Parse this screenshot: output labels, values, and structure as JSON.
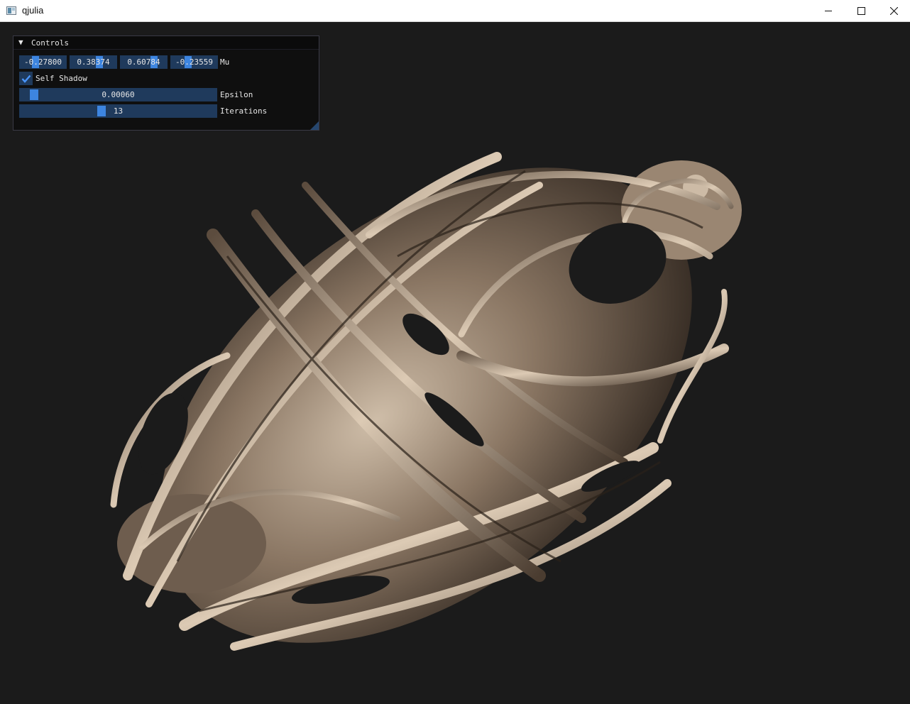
{
  "window": {
    "title": "qjulia",
    "controls": {
      "minimize": "minimize-icon",
      "maximize": "maximize-icon",
      "close": "close-icon"
    }
  },
  "panel": {
    "title": "Controls",
    "mu": {
      "label": "Mu",
      "values": [
        "-0.27800",
        "0.38374",
        "0.60784",
        "-0.23559"
      ]
    },
    "self_shadow": {
      "label": "Self Shadow",
      "checked": true
    },
    "epsilon": {
      "label": "Epsilon",
      "value": "0.00060",
      "fraction": 0.05
    },
    "iterations": {
      "label": "Iterations",
      "value": "13",
      "fraction": 0.41
    }
  },
  "colors": {
    "viewport_bg": "#1b1b1b",
    "frame_bg": "#1f3a5c",
    "accent": "#3d85e0",
    "fractal": "#a89480"
  }
}
